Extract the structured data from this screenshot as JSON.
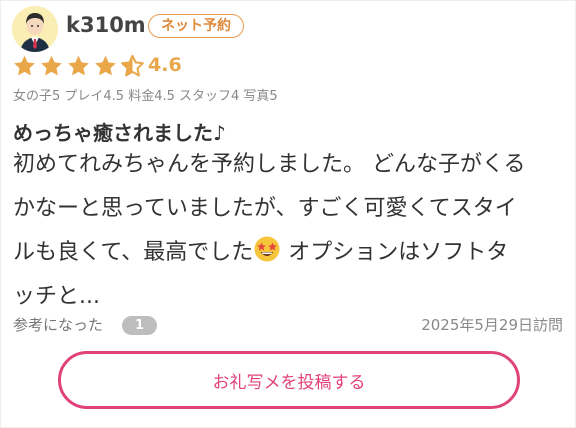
{
  "review": {
    "username": "k310m",
    "badge": "ネット予約",
    "rating": 4.6,
    "rating_text": "4.6",
    "subscores": "女の子5 プレイ4.5 料金4.5 スタッフ4 写真5",
    "title": "めっちゃ癒されました♪",
    "body_lines": [
      "初めてれみちゃんを予約しました。 どんな子がくる",
      "かなーと思っていましたが、すごく可愛くてスタイ",
      "ルも良くて、最高でした",
      " オプションはソフトタ",
      "ッチと..."
    ],
    "helpful_label": "参考になった",
    "helpful_count": "1",
    "visit_date": "2025年5月29日訪問"
  },
  "cta": {
    "label": "お礼写メを投稿する"
  },
  "colors": {
    "star": "#e9a74a",
    "badge": "#e08a3c",
    "cta": "#e0427b"
  },
  "icons": {
    "avatar": "businessman-avatar",
    "emoji": "star-struck-emoji"
  }
}
